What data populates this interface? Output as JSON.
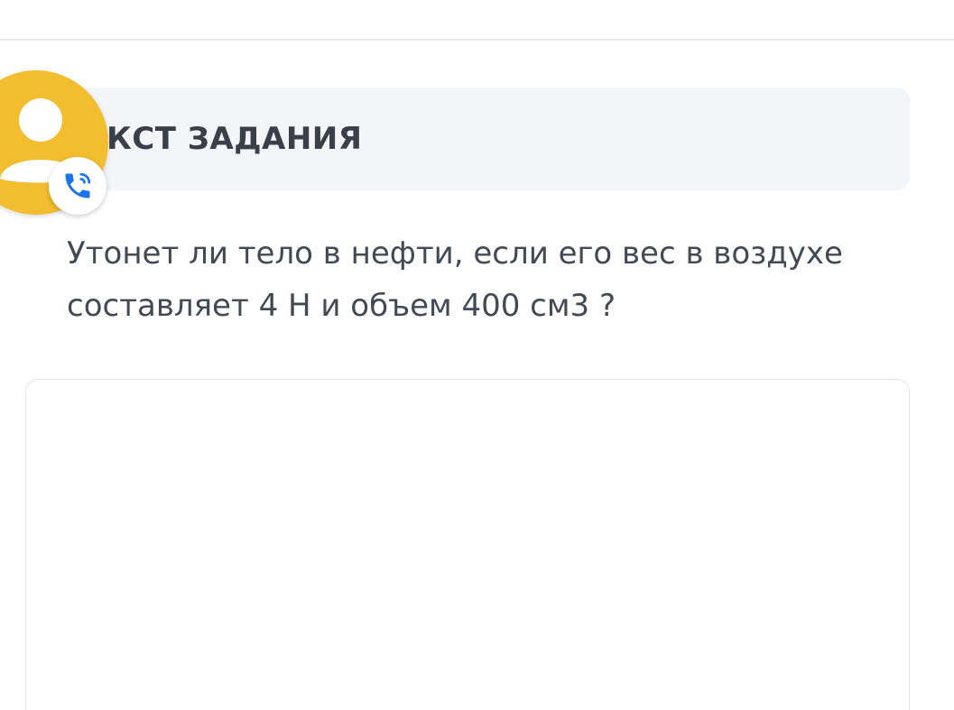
{
  "section": {
    "header_title": "КСТ ЗАДАНИЯ"
  },
  "task": {
    "text": "Утонет ли тело в нефти, если его вес в воздухе составляет 4 Н и объем 400 см3 ?"
  },
  "overlay": {
    "avatar_icon": "person-avatar-icon",
    "call_icon": "phone-call-icon",
    "avatar_color": "#f2bd2e",
    "call_icon_color": "#1a73e8"
  }
}
